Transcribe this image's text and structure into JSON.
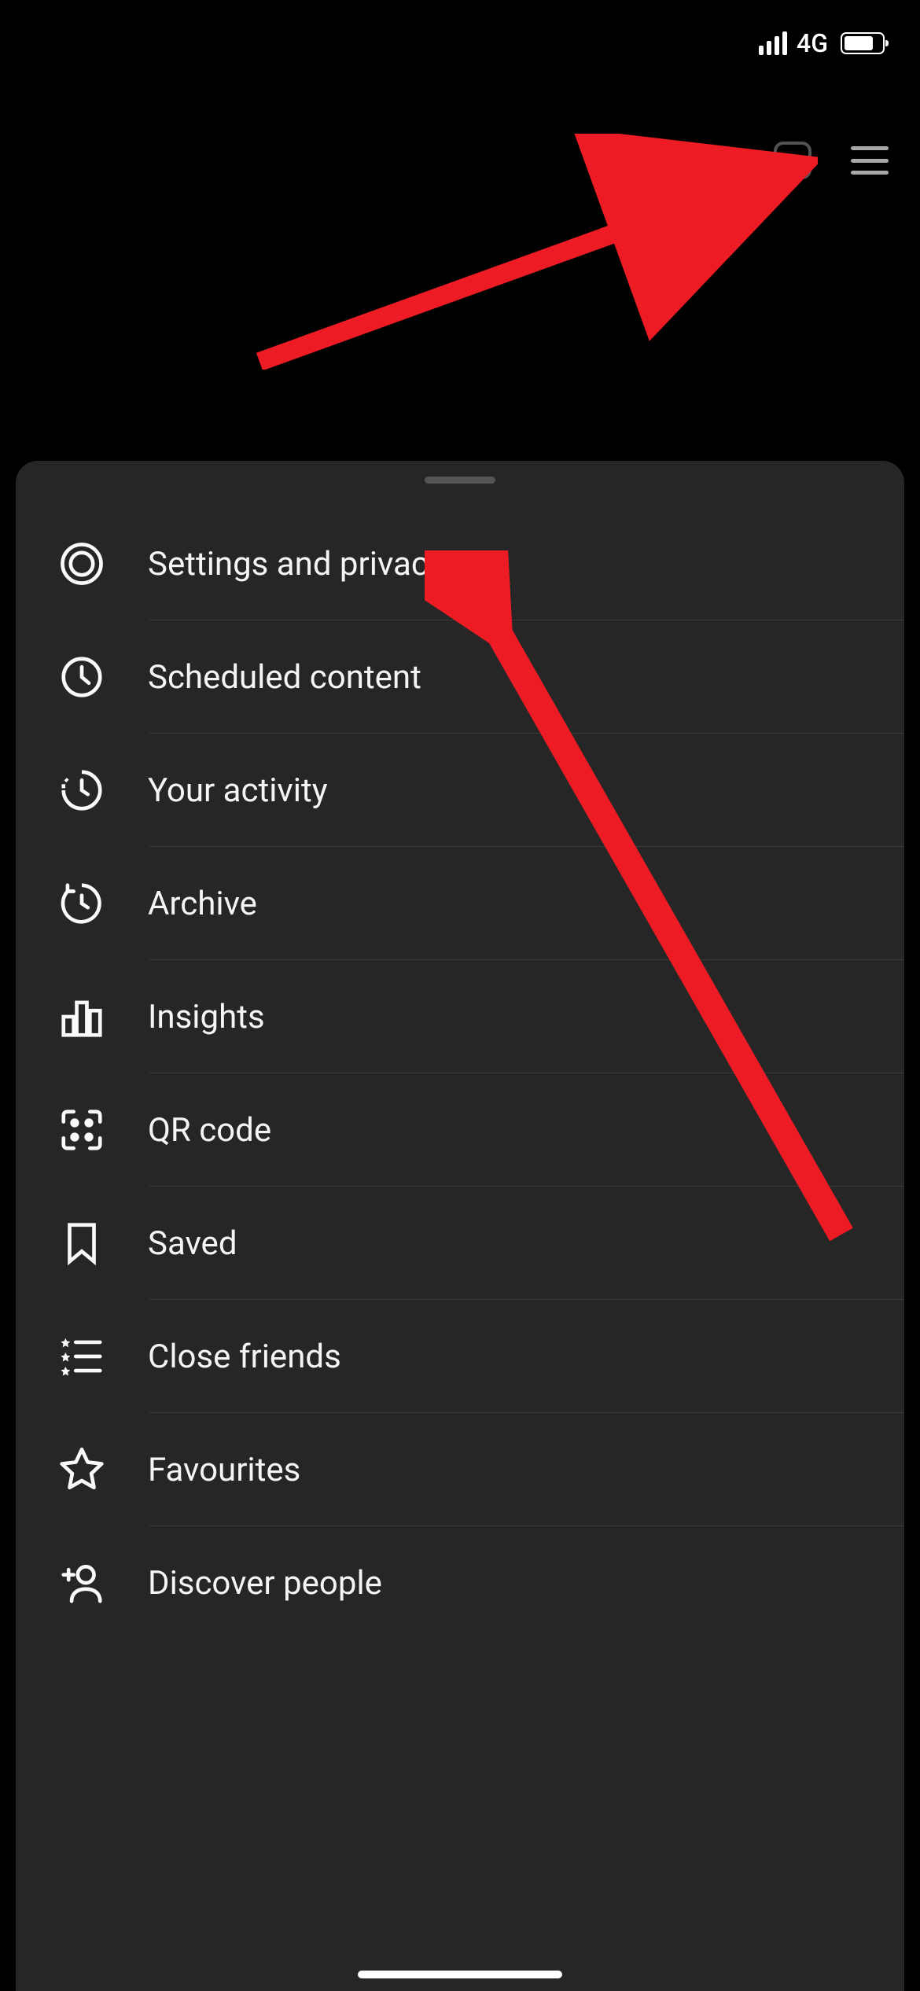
{
  "statusbar": {
    "network_type": "4G"
  },
  "menu": {
    "items": [
      {
        "label": "Settings and privacy",
        "icon": "gear-icon"
      },
      {
        "label": "Scheduled content",
        "icon": "clock-icon"
      },
      {
        "label": "Your activity",
        "icon": "activity-icon"
      },
      {
        "label": "Archive",
        "icon": "archive-icon"
      },
      {
        "label": "Insights",
        "icon": "insights-icon"
      },
      {
        "label": "QR code",
        "icon": "qrcode-icon"
      },
      {
        "label": "Saved",
        "icon": "bookmark-icon"
      },
      {
        "label": "Close friends",
        "icon": "closefriends-icon"
      },
      {
        "label": "Favourites",
        "icon": "star-icon"
      },
      {
        "label": "Discover people",
        "icon": "addperson-icon"
      }
    ]
  },
  "annotations": {
    "arrow1_target": "hamburger-menu",
    "arrow2_target": "menu-item-settings-and-privacy"
  }
}
